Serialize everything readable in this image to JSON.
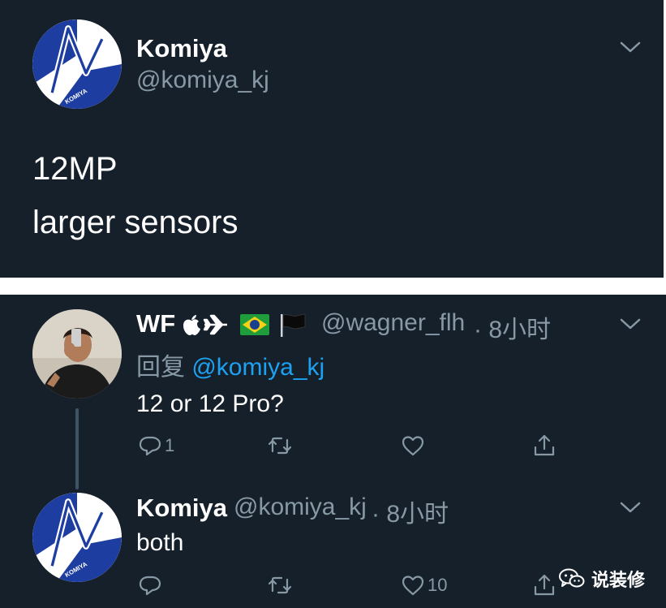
{
  "tweet": {
    "name": "Komiya",
    "handle": "@komiya_kj",
    "lines": [
      "12MP",
      "larger sensors"
    ],
    "avatar_text": "KOMIYA"
  },
  "reply1": {
    "name": "WF",
    "handle": "@wagner_flh",
    "time": "· 8小时",
    "reply_prefix": "回复",
    "reply_to": "@komiya_kj",
    "text": "12 or 12 Pro?",
    "reply_count": "1",
    "like_count": ""
  },
  "reply2": {
    "name": "Komiya",
    "handle": "@komiya_kj",
    "time": "· 8小时",
    "text": "both",
    "like_count": "10",
    "avatar_text": "KOMIYA"
  },
  "watermark": {
    "text": "说装修"
  },
  "colors": {
    "background": "#15202b",
    "secondary_text": "#8899a6",
    "link": "#1da1f2",
    "avatar_blue": "#1d3ea0"
  },
  "icons": [
    "chevron-down-icon",
    "reply-icon",
    "retweet-icon",
    "like-icon",
    "share-icon",
    "apple-icon",
    "airplane-icon",
    "brazil-flag-icon",
    "black-flag-icon",
    "wechat-icon"
  ]
}
